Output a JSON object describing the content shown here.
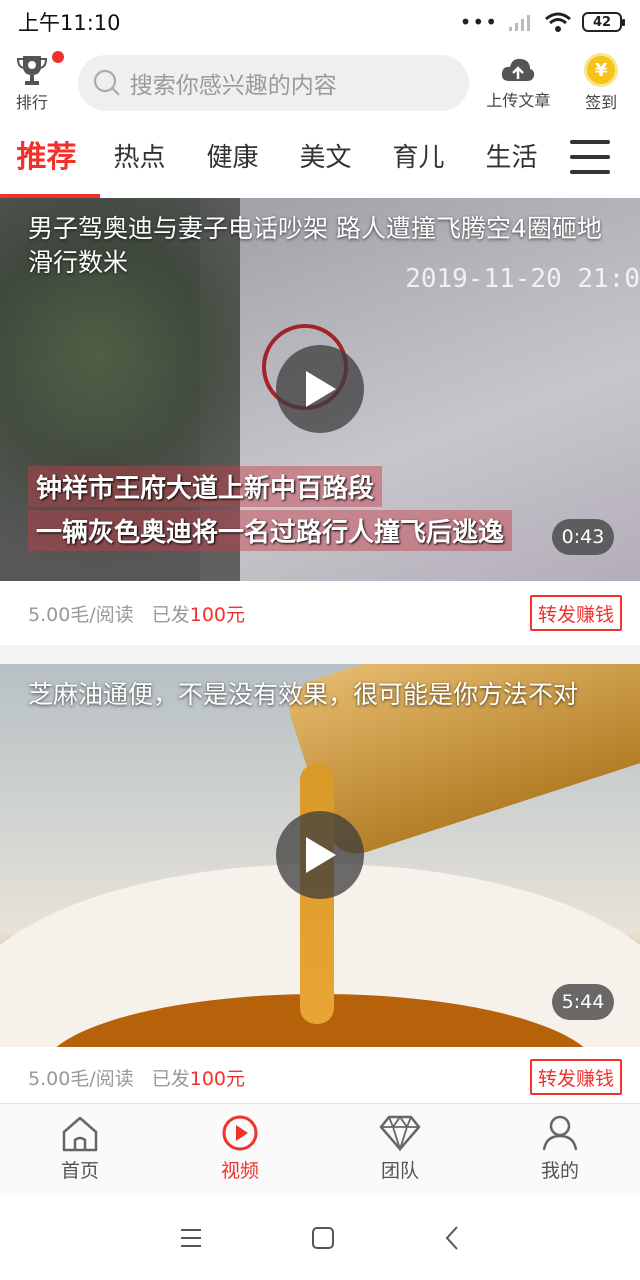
{
  "status_bar": {
    "time": "上午11:10",
    "battery": "42",
    "dots": "•••"
  },
  "header": {
    "rank_label": "排行",
    "search_placeholder": "搜索你感兴趣的内容",
    "upload_label": "上传文章",
    "signin_label": "签到",
    "coin_symbol": "¥"
  },
  "tabs": [
    {
      "label": "推荐",
      "active": true
    },
    {
      "label": "热点"
    },
    {
      "label": "健康"
    },
    {
      "label": "美文"
    },
    {
      "label": "育儿"
    },
    {
      "label": "生活"
    }
  ],
  "videos": [
    {
      "title": "男子驾奥迪与妻子电话吵架 路人遭撞飞腾空4圈砸地滑行数米",
      "overlay_line1": "钟祥市王府大道上新中百路段",
      "overlay_line2": "一辆灰色奥迪将一名过路行人撞飞后逃逸",
      "timestamp": "2019-11-20 21:0",
      "duration": "0:43",
      "rate": "5.00毛/阅读",
      "sent_prefix": "已发",
      "sent_amount": "100元",
      "share_label": "转发赚钱"
    },
    {
      "title": "芝麻油通便，不是没有效果，很可能是你方法不对",
      "duration": "5:44",
      "rate": "5.00毛/阅读",
      "sent_prefix": "已发",
      "sent_amount": "100元",
      "share_label": "转发赚钱"
    }
  ],
  "bottom_nav": [
    {
      "label": "首页",
      "icon": "home-icon"
    },
    {
      "label": "视频",
      "icon": "video-play-icon",
      "active": true
    },
    {
      "label": "团队",
      "icon": "diamond-icon"
    },
    {
      "label": "我的",
      "icon": "user-icon"
    }
  ],
  "colors": {
    "accent": "#f2312b",
    "coin": "#f7c21a"
  }
}
